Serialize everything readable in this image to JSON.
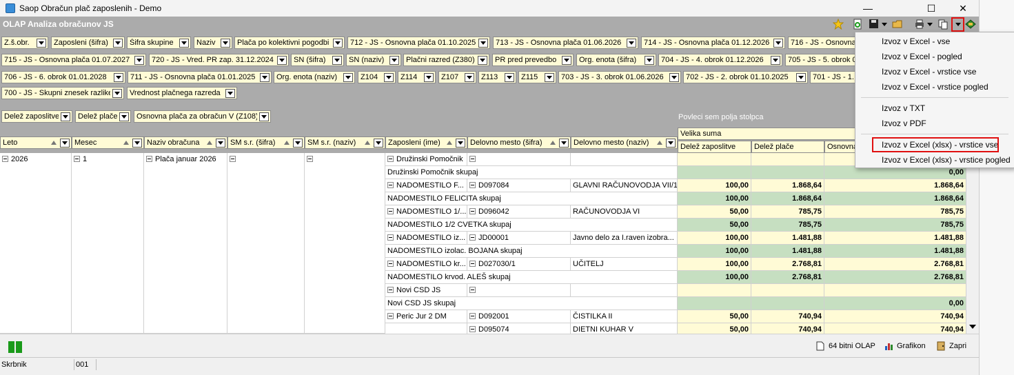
{
  "window": {
    "title": "Saop Obračun plač zaposlenih - Demo",
    "minimize": "—",
    "maximize": "☐",
    "close": "✕"
  },
  "olap": {
    "title": "OLAP Analiza obračunov JS"
  },
  "filters": {
    "row1": [
      "Z.š.obr.",
      "Zaposleni (šifra)",
      "Šifra skupine",
      "Naziv",
      "Plača po kolektivni pogodbi",
      "712 - JS - Osnovna plača 01.10.2025",
      "713 - JS - Osnovna plača 01.06.2026",
      "714 - JS - Osnovna plača 01.12.2026",
      "716 - JS - Osnovna"
    ],
    "row2": [
      "715 - JS - Osnovna plača 01.07.2027",
      "720 - JS - Vred. PR zap. 31.12.2024",
      "SN (šifra)",
      "SN (naziv)",
      "Plačni razred (Z380)",
      "PR pred prevedbo",
      "Org. enota (šifra)",
      "704 - JS - 4. obrok 01.12.2026",
      "705 - JS - 5. obrok 01"
    ],
    "row3": [
      "706 - JS - 6. obrok 01.01.2028",
      "711 - JS - Osnovna plača 01.01.2025",
      "Org. enota (naziv)",
      "Z104",
      "Z114",
      "Z107",
      "Z113",
      "Z115",
      "703 - JS - 3. obrok 01.06.2026",
      "702 - JS - 2. obrok 01.10.2025",
      "701 - JS - 1. o"
    ],
    "row4": [
      "700 - JS - Skupni znesek razlike",
      "Vrednost plačnega razreda"
    ]
  },
  "data_fields": [
    "Delež zaposlitve",
    "Delež plače",
    "Osnovna plača za obračun V (Z108)"
  ],
  "column_dropzone": "Povleci sem polja stolpca",
  "velika_suma": "Velika suma",
  "row_headers": [
    "Leto",
    "Mesec",
    "Naziv obračuna",
    "SM s.r. (šifra)",
    "SM s.r. (naziv)",
    "Zaposleni (ime)",
    "Delovno mesto (šifra)",
    "Delovno mesto (naziv)"
  ],
  "measure_headers": [
    "Delež zaposlitve",
    "Delež plače",
    "Osnovna"
  ],
  "grid": {
    "leto": "2026",
    "mesec": "1",
    "naziv": "Plača januar 2026",
    "rows": [
      {
        "type": "group",
        "name": "Družinski Pomočnik",
        "sifra": "",
        "dm": "",
        "v1": "",
        "v2": "",
        "v3": ""
      },
      {
        "type": "sum",
        "name": "Družinski Pomočnik skupaj",
        "v1": "",
        "v2": "",
        "v3": "0,00"
      },
      {
        "type": "group",
        "name": "NADOMESTILO F...",
        "sifra": "D097084",
        "dm": "GLAVNI RAČUNOVODJA VII/1",
        "v1": "100,00",
        "v2": "1.868,64",
        "v3": "1.868,64"
      },
      {
        "type": "sum",
        "name": "NADOMESTILO FELICITA skupaj",
        "v1": "100,00",
        "v2": "1.868,64",
        "v3": "1.868,64"
      },
      {
        "type": "group",
        "name": "NADOMESTILO 1/...",
        "sifra": "D096042",
        "dm": "RAČUNOVODJA VI",
        "v1": "50,00",
        "v2": "785,75",
        "v3": "785,75"
      },
      {
        "type": "sum",
        "name": "NADOMESTILO 1/2 CVETKA skupaj",
        "v1": "50,00",
        "v2": "785,75",
        "v3": "785,75"
      },
      {
        "type": "group",
        "name": "NADOMESTILO iz...",
        "sifra": "JD00001",
        "dm": "Javno delo za I.raven izobra...",
        "v1": "100,00",
        "v2": "1.481,88",
        "v3": "1.481,88"
      },
      {
        "type": "sum",
        "name": "NADOMESTILO izolac. BOJANA skupaj",
        "v1": "100,00",
        "v2": "1.481,88",
        "v3": "1.481,88"
      },
      {
        "type": "group",
        "name": "NADOMESTILO kr...",
        "sifra": "D027030/1",
        "dm": "UČITELJ",
        "v1": "100,00",
        "v2": "2.768,81",
        "v3": "2.768,81"
      },
      {
        "type": "sum",
        "name": "NADOMESTILO krvod. ALEŠ skupaj",
        "v1": "100,00",
        "v2": "2.768,81",
        "v3": "2.768,81"
      },
      {
        "type": "group",
        "name": "Novi CSD JS",
        "sifra": "",
        "dm": "",
        "v1": "",
        "v2": "",
        "v3": ""
      },
      {
        "type": "sum",
        "name": "Novi CSD JS skupaj",
        "v1": "",
        "v2": "",
        "v3": "0,00"
      },
      {
        "type": "group",
        "name": "Peric Jur 2 DM",
        "sifra": "D092001",
        "dm": "ČISTILKA II",
        "v1": "50,00",
        "v2": "740,94",
        "v3": "740,94"
      },
      {
        "type": "sub",
        "name": "",
        "sifra": "D095074",
        "dm": "DIETNI KUHAR V",
        "v1": "50,00",
        "v2": "740,94",
        "v3": "740,94"
      }
    ]
  },
  "bottom": {
    "olap64": "64 bitni OLAP",
    "grafikon": "Grafikon",
    "zapri": "Zapri"
  },
  "status": {
    "user": "Skrbnik",
    "code": "001"
  },
  "export_menu": {
    "items": [
      "Izvoz v Excel - vse",
      "Izvoz v Excel - pogled",
      "Izvoz v Excel - vrstice vse",
      "Izvoz v Excel - vrstice pogled",
      "Izvoz v TXT",
      "Izvoz v PDF",
      "Izvoz v Excel (xlsx) - vrstice vse",
      "Izvoz v Excel (xlsx) - vrstice pogled"
    ],
    "highlighted": "Izvoz v Excel (xlsx) - vrstice vse"
  },
  "colors": {
    "chip_bg": "#fffbd6",
    "sum_green": "#c6dfc1",
    "panel_gray": "#ababab",
    "highlight_red": "#e01010"
  }
}
